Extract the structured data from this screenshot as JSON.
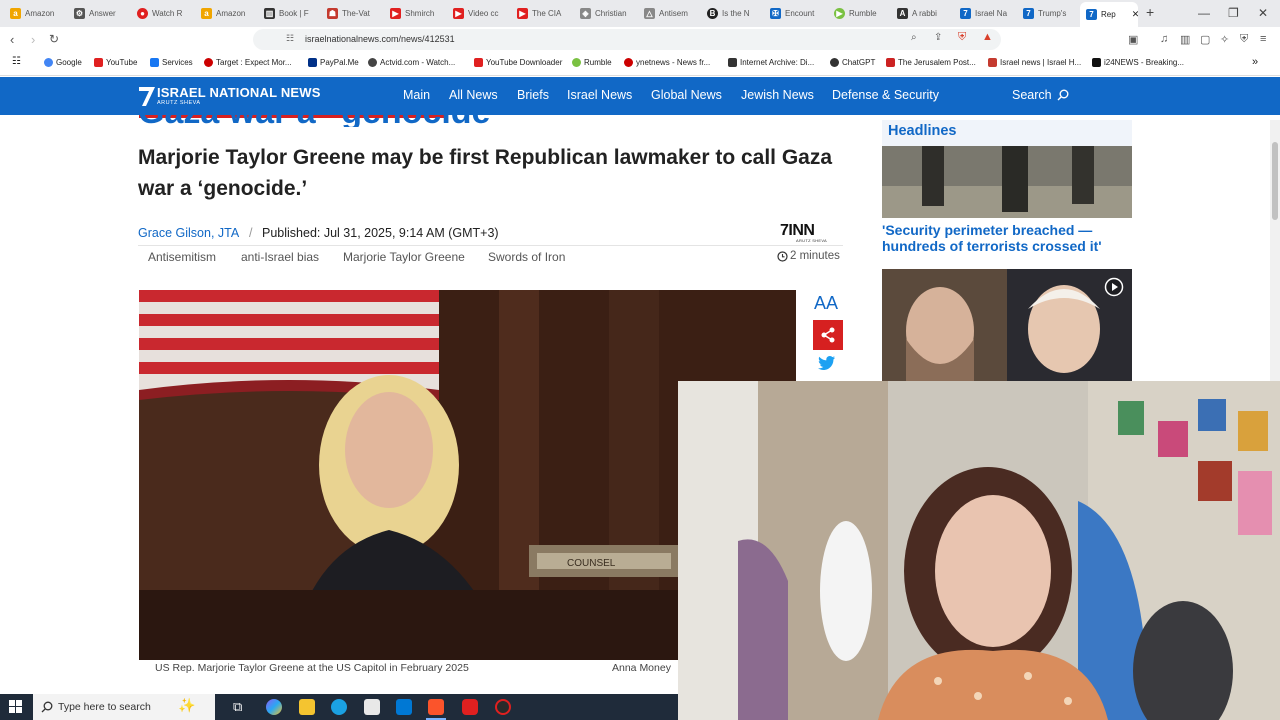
{
  "browser": {
    "tabs": [
      {
        "label": "Amazon",
        "color": "#f0a500",
        "glyph": "a"
      },
      {
        "label": "Answer",
        "color": "#555555",
        "glyph": "⚙"
      },
      {
        "label": "Watch R",
        "color": "#e02020",
        "glyph": "●"
      },
      {
        "label": "Amazon",
        "color": "#f0a500",
        "glyph": "a"
      },
      {
        "label": "Book | F",
        "color": "#333333",
        "glyph": "▥"
      },
      {
        "label": "The-Vat",
        "color": "#c43a2f",
        "glyph": "☗"
      },
      {
        "label": "Shmirch",
        "color": "#e02020",
        "glyph": "▶"
      },
      {
        "label": "Video cc",
        "color": "#e02020",
        "glyph": "▶"
      },
      {
        "label": "The CIA",
        "color": "#e02020",
        "glyph": "▶"
      },
      {
        "label": "Christian",
        "color": "#888888",
        "glyph": "◈"
      },
      {
        "label": "Antisem",
        "color": "#888888",
        "glyph": "△"
      },
      {
        "label": "Is the N",
        "color": "#222222",
        "glyph": "B"
      },
      {
        "label": "Encount",
        "color": "#1168c6",
        "glyph": "✠"
      },
      {
        "label": "Rumble",
        "color": "#7ac142",
        "glyph": "▶"
      },
      {
        "label": "A rabbi",
        "color": "#333333",
        "glyph": "A"
      },
      {
        "label": "Israel Na",
        "color": "#1168c6",
        "glyph": "7"
      },
      {
        "label": "Trump's",
        "color": "#1168c6",
        "glyph": "7"
      },
      {
        "label": "Rep",
        "color": "#1168c6",
        "glyph": "7",
        "active": true
      }
    ],
    "new_tab_label": "+",
    "close_tab_label": "✕",
    "window_controls": {
      "minimize": "—",
      "restore": "❐",
      "close": "✕"
    },
    "url": "israelnationalnews.com/news/412531",
    "bookmarks": [
      {
        "label": "Google",
        "color": "#4285f4"
      },
      {
        "label": "YouTube",
        "color": "#e02020"
      },
      {
        "label": "Services",
        "color": "#1877f2"
      },
      {
        "label": "Target : Expect Mor...",
        "color": "#cc0000"
      },
      {
        "label": "PayPal.Me",
        "color": "#003087"
      },
      {
        "label": "Actvid.com - Watch...",
        "color": "#444444"
      },
      {
        "label": "YouTube Downloader",
        "color": "#e02020"
      },
      {
        "label": "Rumble",
        "color": "#7ac142"
      },
      {
        "label": "ynetnews - News fr...",
        "color": "#cc0000"
      },
      {
        "label": "Internet Archive: Di...",
        "color": "#333333"
      },
      {
        "label": "ChatGPT",
        "color": "#333333"
      },
      {
        "label": "The Jerusalem Post...",
        "color": "#cc2222"
      },
      {
        "label": "Israel news | Israel H...",
        "color": "#c43a2f"
      },
      {
        "label": "i24NEWS - Breaking...",
        "color": "#111111"
      }
    ]
  },
  "site": {
    "logo_title": "ISRAEL NATIONAL NEWS",
    "logo_sub": "ARUTZ SHEVA",
    "nav": [
      "Main",
      "All News",
      "Briefs",
      "Israel News",
      "Global News",
      "Jewish News",
      "Defense & Security"
    ],
    "search_label": "Search"
  },
  "article": {
    "title_partial": "Gaza war a \"genocide\"",
    "subtitle": "Marjorie Taylor Greene may be first Republican lawmaker to call Gaza war a ‘genocide.’",
    "author": "Grace Gilson, JTA",
    "separator": "/",
    "published": "Published: Jul 31, 2025, 9:14 AM (GMT+3)",
    "publisher_logo": "7INN",
    "publisher_logo_sub": "ARUTZ SHEVA",
    "tags": [
      "Antisemitism",
      "anti-Israel bias",
      "Marjorie Taylor Greene",
      "Swords of Iron"
    ],
    "read_time": "2 minutes",
    "photo_placard": "COUNSEL",
    "caption": "US Rep. Marjorie Taylor Greene at the US Capitol in February 2025",
    "credit": "Anna Money"
  },
  "tools": {
    "font_size_label": "AA"
  },
  "sidebar": {
    "heading": "Headlines",
    "headline_1": "'Security perimeter breached — hundreds of terrorists crossed it'"
  },
  "taskbar": {
    "search_placeholder": "Type here to search"
  },
  "colors": {
    "brand": "#1168c6",
    "share": "#d62020"
  }
}
